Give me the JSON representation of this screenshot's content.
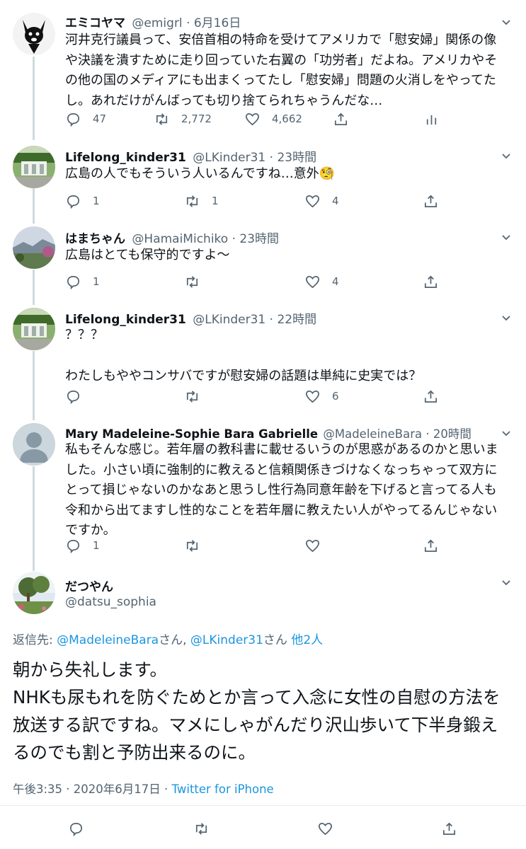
{
  "tweets": [
    {
      "name": "エミコヤマ",
      "handle": "@emigrl",
      "time": "· 6月16日",
      "text": "河井克行議員って、安倍首相の特命を受けてアメリカで「慰安婦」関係の像や決議を潰すために走り回っていた右翼の「功労者」だよね。アメリカやその他の国のメディアにも出まくってたし「慰安婦」問題の火消しをやってたし。あれだけがんばっても切り捨てられちゃうんだな…",
      "replies": "47",
      "retweets": "2,772",
      "likes": "4,662",
      "avatar": "chihuahua-cartoon-avatar"
    },
    {
      "name": "Lifelong_kinder31",
      "handle": "@LKinder31",
      "time": "· 23時間",
      "text": "広島の人でもそういう人いるんですね…意外🧐",
      "replies": "1",
      "retweets": "1",
      "likes": "4",
      "avatar": "garden-pavilion-photo-avatar"
    },
    {
      "name": "はまちゃん",
      "handle": "@HamaiMichiko",
      "time": "· 23時間",
      "text": "広島はとても保守的ですよ〜",
      "replies": "1",
      "retweets": "",
      "likes": "4",
      "avatar": "mountain-landscape-avatar"
    },
    {
      "name": "Lifelong_kinder31",
      "handle": "@LKinder31",
      "time": "· 22時間",
      "text": "？？？\n\nわたしもややコンサバですが慰安婦の話題は単純に史実では？",
      "replies": "",
      "retweets": "",
      "likes": "6",
      "avatar": "garden-pavilion-photo-avatar"
    },
    {
      "name": "Mary Madeleine-Sophie Bara Gabrielle",
      "handle": "@MadeleineBara",
      "time": "· 20時間",
      "text": "私もそんな感じ。若年層の教科書に載せるいうのが思惑があるのかと思いました。小さい頃に強制的に教えると信頼関係きづけなくなっちゃって双方にとって損じゃないのかなあと思うし性行為同意年齢を下げると言ってる人も令和から出てますし性的なことを若年層に教えたい人がやってるんじゃないですか。",
      "replies": "1",
      "retweets": "",
      "likes": "",
      "avatar": "default-user-avatar"
    }
  ],
  "focused": {
    "name": "だつやん",
    "handle": "@datsu_sophia",
    "reply_prefix": "返信先: ",
    "reply_user1": "@MadeleineBara",
    "reply_san1": "さん, ",
    "reply_user2": "@LKinder31",
    "reply_san2": "さん ",
    "reply_others": "他2人",
    "text": "朝から失礼します。\nNHKも尿もれを防ぐためとか言って入念に女性の自慰の方法を放送する訳ですね。マメにしゃがんだり沢山歩いて下半身鍛えるのでも割と予防出来るのに。",
    "timestamp": "午後3:35 · 2020年6月17日 · ",
    "client": "Twitter for iPhone",
    "avatar": "park-trees-photo-avatar"
  },
  "colors": {
    "accent": "#1b95e0",
    "muted": "#536471",
    "text": "#0f1419",
    "thread_line": "#cfd9de"
  }
}
